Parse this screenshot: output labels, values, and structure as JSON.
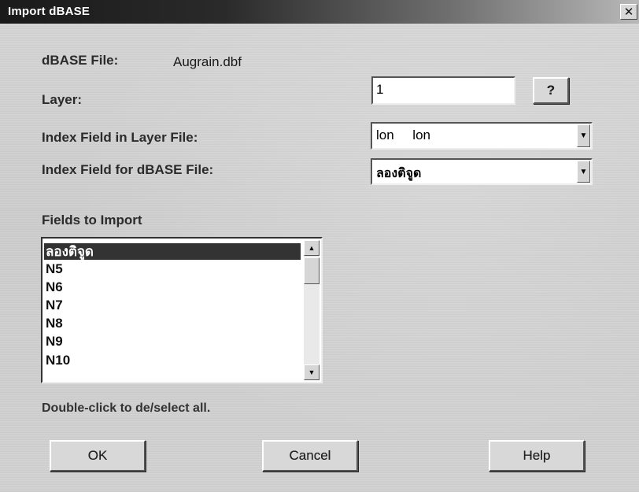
{
  "window": {
    "title": "Import dBASE",
    "close_glyph": "✕"
  },
  "dbase_file": {
    "label": "dBASE File:",
    "value": "Augrain.dbf"
  },
  "layer": {
    "label": "Layer:",
    "value": "1",
    "help_label": "?"
  },
  "index_field_layer": {
    "label": "Index Field in Layer File:",
    "value": "lon     lon"
  },
  "index_field_dbase": {
    "label": "Index Field for dBASE File:",
    "value": "ลองติจูด"
  },
  "fields": {
    "label": "Fields to Import",
    "items": [
      "ลองติจูด",
      "N5",
      "N6",
      "N7",
      "N8",
      "N9",
      "N10"
    ],
    "selected_index": 0,
    "hint": "Double-click to de/select all."
  },
  "buttons": {
    "ok": "OK",
    "cancel": "Cancel",
    "help": "Help"
  },
  "icons": {
    "dropdown": "dropdown-arrow-icon",
    "scroll_up": "scroll-up-icon",
    "scroll_down": "scroll-down-icon"
  },
  "colors": {
    "title_bar": "#1a1a1a",
    "selection": "#333333"
  }
}
